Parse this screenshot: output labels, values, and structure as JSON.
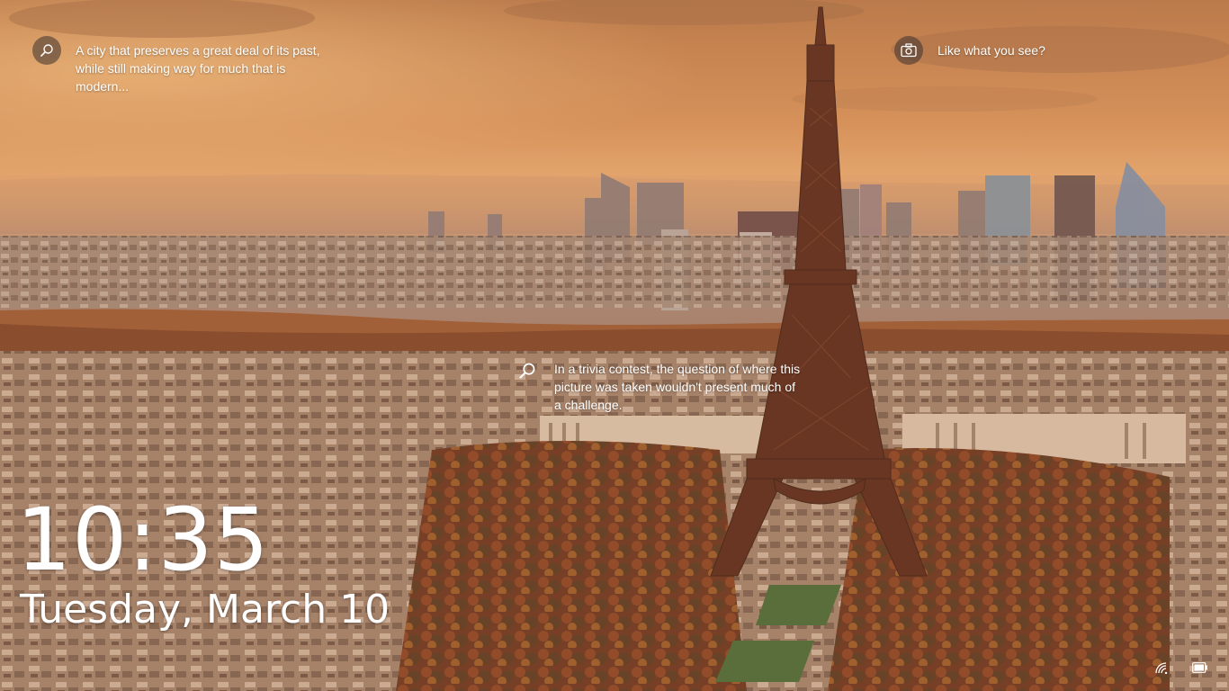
{
  "lockscreen": {
    "hints": {
      "top_left": "A city that preserves a great deal of its past, while still making way for much that is modern...",
      "top_right": "Like what you see?",
      "center": "In a trivia contest, the question of where this picture was taken wouldn't present much of a challenge."
    },
    "time": "10:35",
    "date": "Tuesday, March 10"
  },
  "icons": {
    "hint_top_left": "search-icon",
    "hint_top_right": "camera-icon",
    "hint_center": "search-icon",
    "network": "network-icon",
    "battery": "battery-icon"
  },
  "colors": {
    "sky_top": "#c9884f",
    "sky_horizon": "#e0a06a",
    "city": "#8a6a58",
    "tower": "#5a2e1e",
    "trees": "#7a3a22"
  }
}
